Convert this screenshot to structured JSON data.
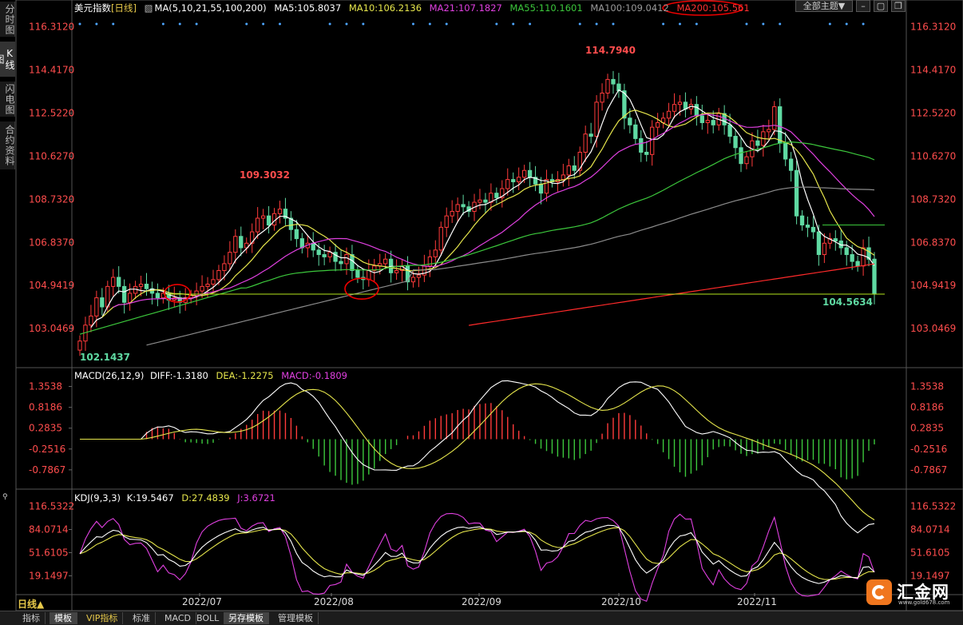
{
  "window": {
    "side_tabs": [
      "分时图",
      "K线图",
      "闪电图",
      "合约资料"
    ],
    "topic_button": "全部主题▼"
  },
  "main_panel": {
    "legend": {
      "symbol": "美元指数",
      "period_tag": "[日线]",
      "ma_params": "MA(5,10,21,55,100,200)",
      "ma5": "MA5:105.8037",
      "ma10": "MA10:106.2136",
      "ma21": "MA21:107.1827",
      "ma55": "MA55:110.1601",
      "ma100": "MA100:109.0412",
      "ma200": "MA200:105.561"
    },
    "colors": {
      "up": "#ff3b3b",
      "down": "#5fd9a2",
      "ma5": "#ffffff",
      "ma10": "#e6e64c",
      "ma21": "#e040e0",
      "ma55": "#3cc83c",
      "ma100": "#8c8c8c",
      "ma200": "#ff2a2a",
      "axis_label": "#ff4d4d"
    }
  },
  "macd_panel": {
    "legend": {
      "name": "MACD(26,12,9)",
      "diff": "DIFF:-1.3180",
      "dea": "DEA:-1.2275",
      "macd": "MACD:-0.1809"
    }
  },
  "kdj_panel": {
    "legend": {
      "name": "KDJ(9,3,3)",
      "k": "K:19.5467",
      "d": "D:27.4839",
      "j": "J:3.6721"
    }
  },
  "bottom": {
    "period": "日线▲",
    "tabs": [
      "指标",
      "模板",
      "VIP指标",
      "标准",
      "MACD",
      "BOLL",
      "另存模板",
      "管理模板"
    ],
    "active_tab": "模板",
    "logo_text": "汇金网",
    "logo_site": "www.gold678.com"
  },
  "chart_data": [
    {
      "type": "candlestick",
      "title": "美元指数[日线]",
      "ylim": [
        101.4,
        117.0
      ],
      "y_ticks": [
        "116.3120",
        "114.4170",
        "112.5220",
        "110.6270",
        "108.7320",
        "106.8370",
        "104.9419",
        "103.0469"
      ],
      "x_ticks": [
        "2022/07",
        "2022/08",
        "2022/09",
        "2022/10",
        "2022/11"
      ],
      "annotations": [
        {
          "text": "114.7940",
          "price": 114.794
        },
        {
          "text": "109.3032",
          "price": 109.3032
        },
        {
          "text": "102.1437",
          "price": 102.1437
        },
        {
          "text": "104.5634",
          "price": 104.5634
        }
      ],
      "close_series": [
        102.5,
        103.2,
        103.6,
        104.4,
        104.0,
        104.9,
        105.3,
        104.9,
        104.2,
        104.6,
        104.9,
        105.0,
        104.8,
        104.6,
        104.4,
        104.6,
        104.3,
        104.4,
        104.2,
        104.4,
        104.5,
        104.7,
        104.9,
        105.0,
        105.2,
        105.6,
        105.9,
        106.4,
        107.1,
        106.6,
        106.8,
        107.3,
        107.9,
        108.0,
        107.6,
        108.1,
        108.3,
        107.9,
        107.4,
        107.0,
        106.6,
        106.8,
        106.5,
        106.3,
        106.2,
        106.4,
        106.0,
        105.9,
        106.3,
        105.6,
        105.3,
        105.2,
        105.6,
        105.8,
        105.9,
        106.1,
        105.5,
        105.6,
        105.8,
        105.1,
        105.3,
        105.4,
        105.8,
        106.2,
        106.5,
        107.5,
        108.0,
        108.2,
        108.5,
        108.4,
        108.2,
        108.6,
        108.7,
        108.6,
        109.0,
        108.8,
        109.2,
        109.6,
        109.5,
        109.7,
        110.0,
        109.7,
        109.4,
        109.0,
        109.6,
        109.5,
        109.6,
        109.8,
        110.2,
        110.0,
        110.8,
        111.6,
        111.5,
        113.0,
        113.4,
        114.0,
        113.8,
        113.5,
        112.3,
        112.0,
        111.4,
        110.8,
        110.7,
        111.9,
        112.1,
        112.3,
        112.6,
        112.9,
        113.0,
        112.7,
        112.9,
        112.4,
        112.1,
        112.2,
        112.0,
        112.5,
        112.0,
        111.5,
        111.0,
        110.3,
        110.6,
        111.3,
        111.1,
        111.7,
        111.8,
        112.8,
        111.2,
        110.5,
        110.0,
        108.0,
        107.6,
        107.5,
        107.3,
        106.3,
        106.8,
        107.0,
        106.9,
        106.6,
        106.3,
        106.0,
        105.8,
        106.6,
        106.1,
        104.6
      ],
      "markers": {
        "ma200_circle": "MA200:105.561",
        "support_circles": [
          104.9,
          104.9
        ]
      }
    },
    {
      "type": "bar",
      "title": "MACD(26,12,9)",
      "ylim": [
        -1.2,
        1.55
      ],
      "y_ticks": [
        "1.3538",
        "0.8186",
        "0.2835",
        "-0.2516",
        "-0.7867"
      ],
      "series": [
        {
          "name": "DIFF",
          "value": -1.318
        },
        {
          "name": "DEA",
          "value": -1.2275
        },
        {
          "name": "MACD",
          "value": -0.1809
        }
      ]
    },
    {
      "type": "line",
      "title": "KDJ(9,3,3)",
      "ylim": [
        -5,
        125
      ],
      "y_ticks": [
        "116.5322",
        "84.0714",
        "51.6105",
        "19.1497"
      ],
      "series": [
        {
          "name": "K",
          "value": 19.5467
        },
        {
          "name": "D",
          "value": 27.4839
        },
        {
          "name": "J",
          "value": 3.6721
        }
      ]
    }
  ]
}
